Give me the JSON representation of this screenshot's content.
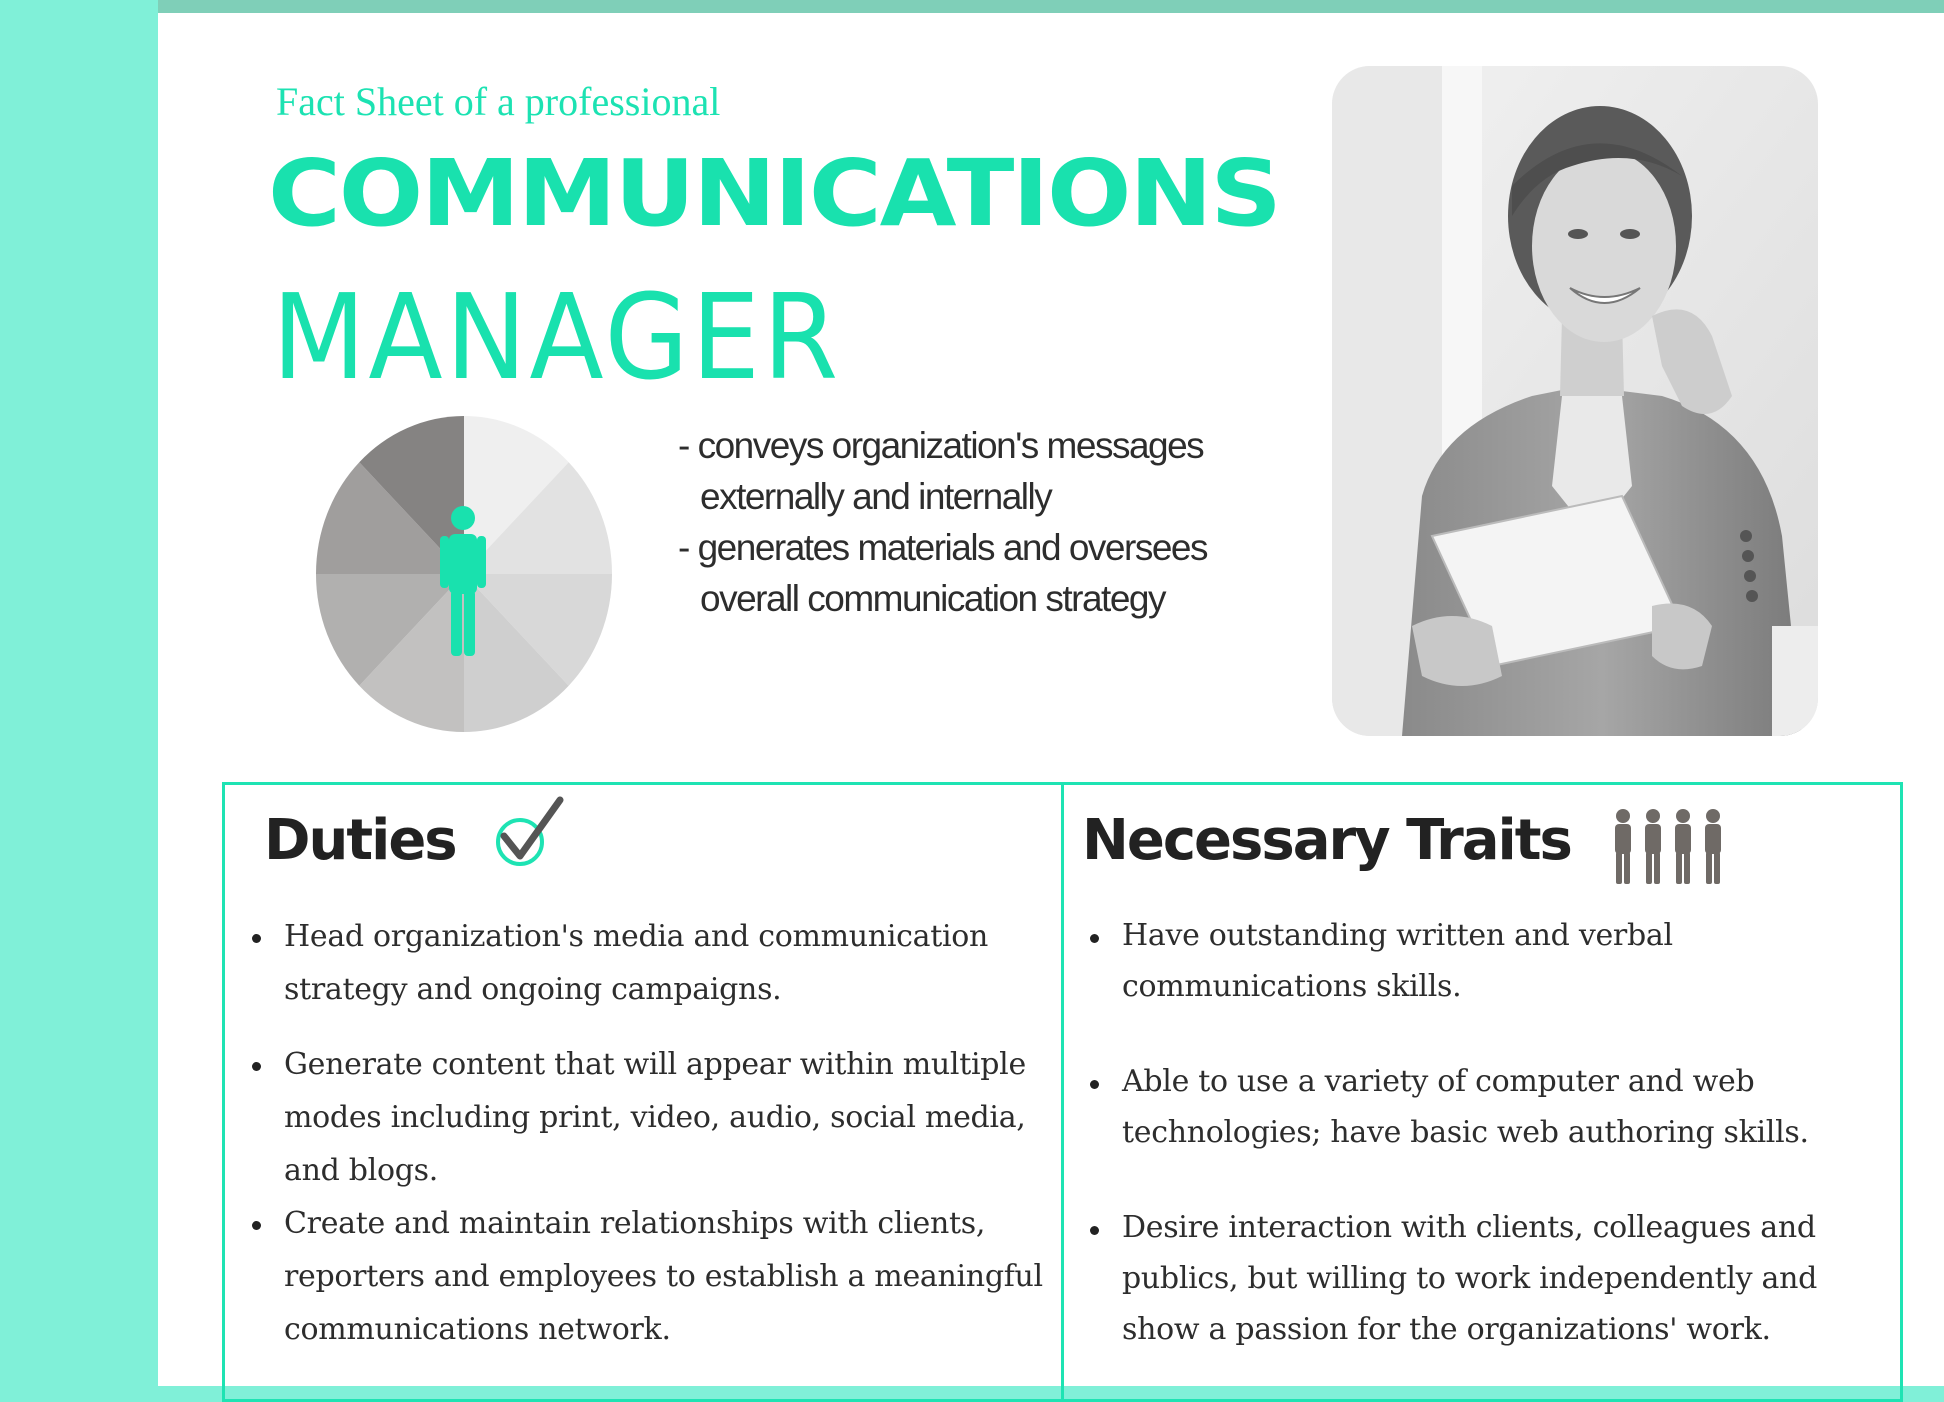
{
  "header": {
    "subtitle": "Fact Sheet of a professional",
    "title_line1": "COMMUNICATIONS",
    "title_line2": "MANAGER"
  },
  "summary": {
    "items": [
      "- conveys organization's messages externally and internally",
      "- generates materials and oversees overall communication strategy"
    ]
  },
  "duties": {
    "heading": "Duties",
    "items": [
      "Head organization's media and communication strategy and ongoing campaigns.",
      "Generate content that will appear within multiple modes including print, video, audio, social media, and blogs.",
      "Create and maintain relationships with clients, reporters and employees to establish a meaningful communications network."
    ]
  },
  "traits": {
    "heading": "Necessary Traits",
    "items": [
      "Have outstanding written and verbal communications skills.",
      "Able to use a variety of computer and web technologies; have basic web authoring skills.",
      "Desire interaction with clients, colleagues and publics, but willing to work independently and show a passion for the organizations' work."
    ]
  },
  "colors": {
    "accent": "#1ce2b2",
    "sidebar": "#80f0d8",
    "top_strip": "#7fcfb8",
    "text": "#2d2d2d"
  },
  "icons": {
    "pie": "person-pie-icon",
    "check": "checkmark-icon",
    "traits": "people-icon",
    "photo": "professional-woman-photo"
  }
}
